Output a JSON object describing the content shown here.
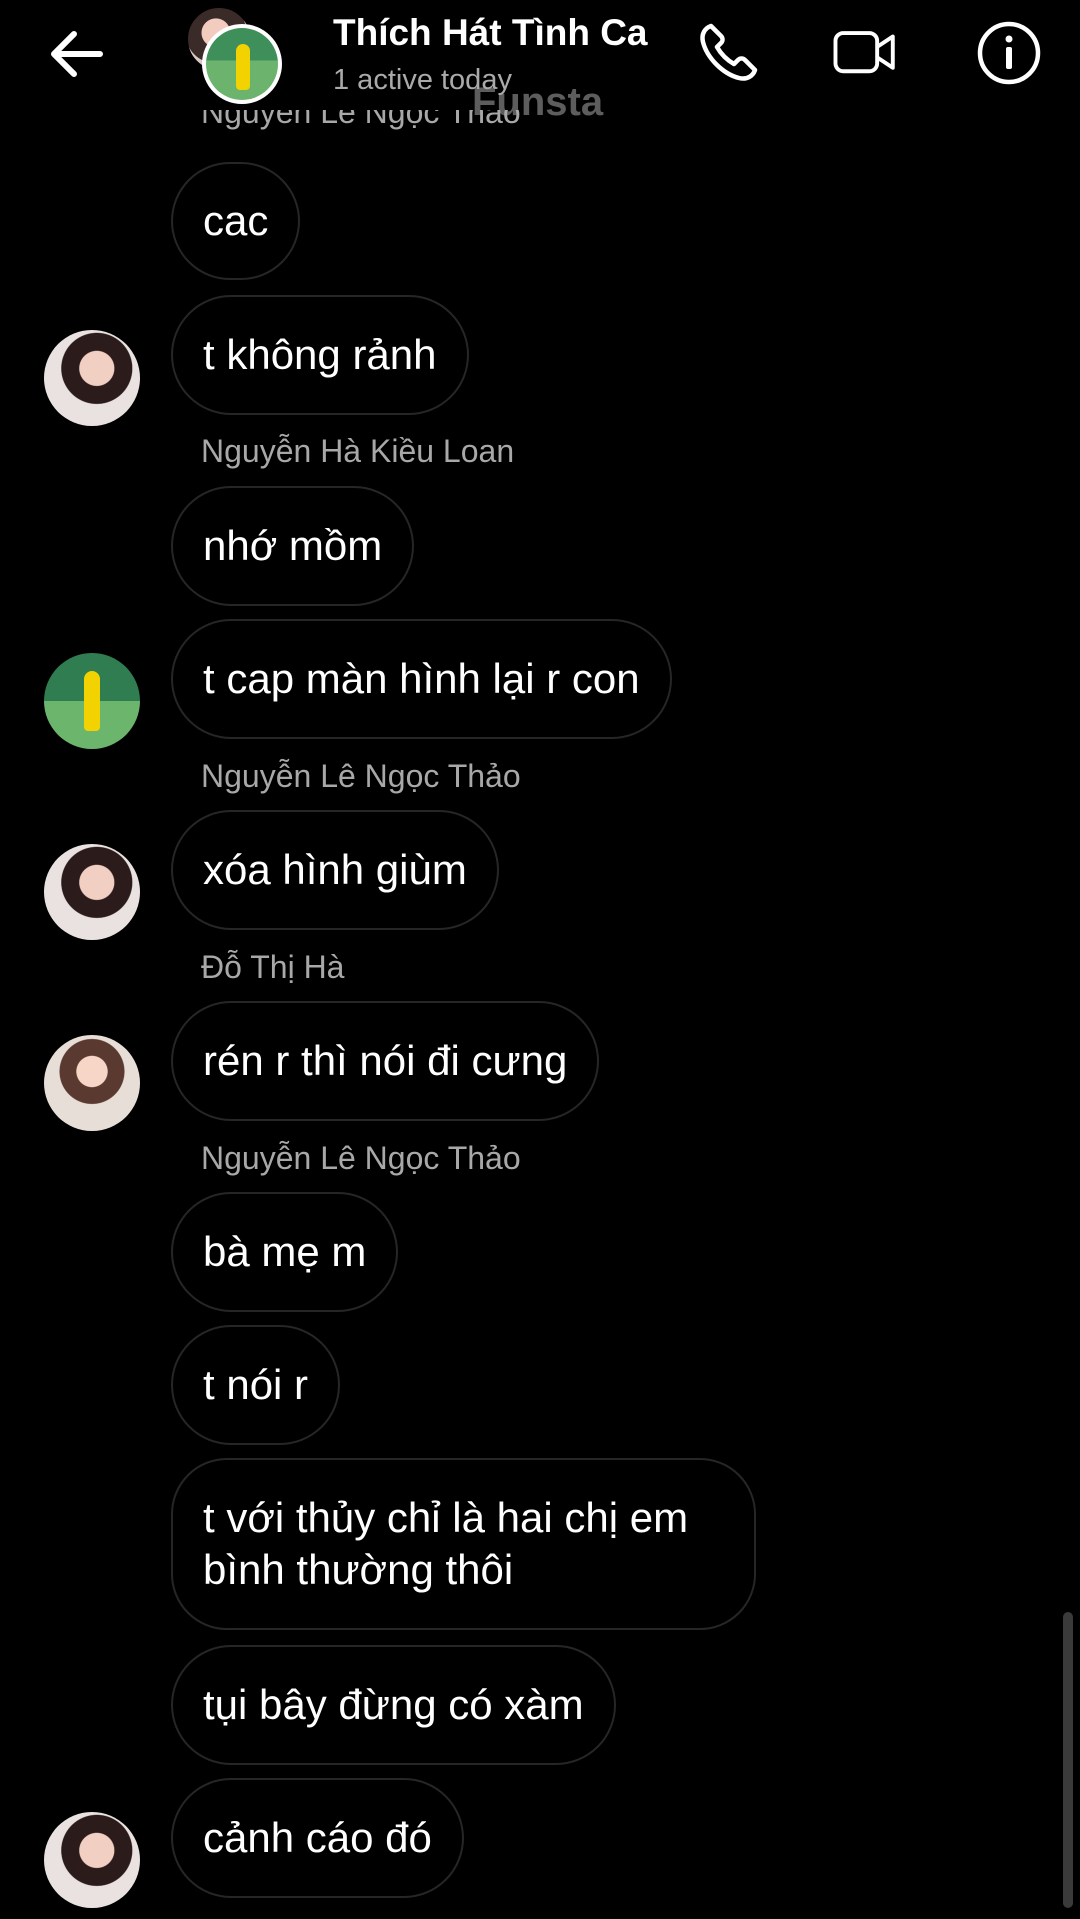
{
  "header": {
    "title": "Thích Hát Tình Ca",
    "status": "1 active today",
    "watermark": "Funsta"
  },
  "messages": [
    {
      "sender": "Nguyễn Lê Ngọc Thảo",
      "text": "cac"
    },
    {
      "text": "t không rảnh"
    },
    {
      "sender": "Nguyễn Hà Kiều Loan",
      "text": "nhớ mồm"
    },
    {
      "text": "t cap màn hình lại r con"
    },
    {
      "sender": "Nguyễn Lê Ngọc Thảo",
      "text": "xóa hình giùm"
    },
    {
      "sender": "Đỗ Thị Hà",
      "text": "rén r thì nói đi cưng"
    },
    {
      "sender": "Nguyễn Lê Ngọc Thảo",
      "text": "bà mẹ m"
    },
    {
      "text": "t nói r"
    },
    {
      "text": "t với thủy chỉ là hai chị em bình thường thôi"
    },
    {
      "text": "tụi bây đừng có xàm"
    },
    {
      "text": "cảnh cáo đó"
    }
  ],
  "icons": [
    "back-arrow-icon",
    "phone-icon",
    "video-camera-icon",
    "info-icon"
  ]
}
